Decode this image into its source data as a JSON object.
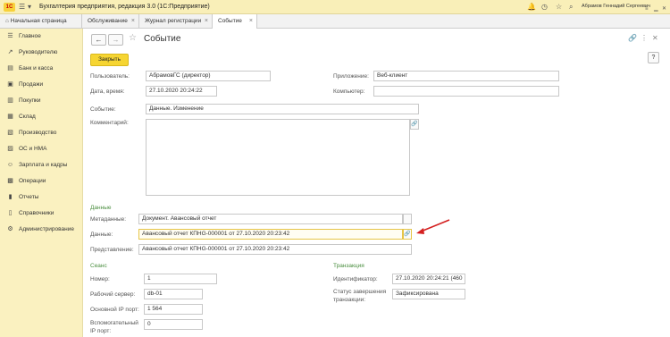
{
  "app": {
    "logo": "1С",
    "title": "Бухгалтерия предприятия, редакция 3.0  (1С:Предприятие)",
    "user": "Абрамов Геннадий Сергеевич"
  },
  "tabs": [
    {
      "label": "Начальная страница",
      "closable": false
    },
    {
      "label": "Обслуживание",
      "closable": true
    },
    {
      "label": "Журнал регистрации",
      "closable": true
    },
    {
      "label": "Событие",
      "closable": true
    }
  ],
  "sidebar": [
    {
      "label": "Главное",
      "icon": "menu-icon"
    },
    {
      "label": "Руководителю",
      "icon": "chart-icon"
    },
    {
      "label": "Банк и касса",
      "icon": "bank-icon"
    },
    {
      "label": "Продажи",
      "icon": "cart-icon"
    },
    {
      "label": "Покупки",
      "icon": "basket-icon"
    },
    {
      "label": "Склад",
      "icon": "warehouse-icon"
    },
    {
      "label": "Производство",
      "icon": "factory-icon"
    },
    {
      "label": "ОС и НМА",
      "icon": "building-icon"
    },
    {
      "label": "Зарплата и кадры",
      "icon": "people-icon"
    },
    {
      "label": "Операции",
      "icon": "operations-icon"
    },
    {
      "label": "Отчеты",
      "icon": "report-icon"
    },
    {
      "label": "Справочники",
      "icon": "book-icon"
    },
    {
      "label": "Администрирование",
      "icon": "gear-icon"
    }
  ],
  "form": {
    "title": "Событие",
    "close_label": "Закрыть",
    "help_label": "?",
    "user_label": "Пользователь:",
    "user_value": "АбрамовГС (директор)",
    "app_label": "Приложение:",
    "app_value": "Веб-клиент",
    "date_label": "Дата, время:",
    "date_value": "27.10.2020 20:24:22",
    "computer_label": "Компьютер:",
    "computer_value": "",
    "event_label": "Событие:",
    "event_value": "Данные. Изменение",
    "comment_label": "Комментарий:",
    "comment_value": "",
    "data_section": "Данные",
    "metadata_label": "Метаданные:",
    "metadata_value": "Документ. Авансовый отчет",
    "data_label": "Данные:",
    "data_value": "Авансовый отчет КПHG-000001 от 27.10.2020 20:23:42",
    "repr_label": "Представление:",
    "repr_value": "Авансовый отчет КПHG-000001 от 27.10.2020 20:23:42",
    "session_section": "Сеанс",
    "number_label": "Номер:",
    "number_value": "1",
    "server_label": "Рабочий сервер:",
    "server_value": "db-01",
    "port_label": "Основной IP порт:",
    "port_value": "1 564",
    "aux_port_label": "Вспомогательный IP порт:",
    "aux_port_value": "0",
    "transaction_section": "Транзакция",
    "id_label": "Идентификатор:",
    "id_value": "27.10.2020 20:24:21 (460",
    "status_label": "Статус завершения транзакции:",
    "status_value": "Зафиксирована"
  },
  "colors": {
    "sidebar_bg": "#faf1c0",
    "titlebar_bg": "#f9efb8",
    "accent_button": "#f6d532",
    "section_green": "#4a8e3f",
    "arrow_red": "#d42020"
  }
}
